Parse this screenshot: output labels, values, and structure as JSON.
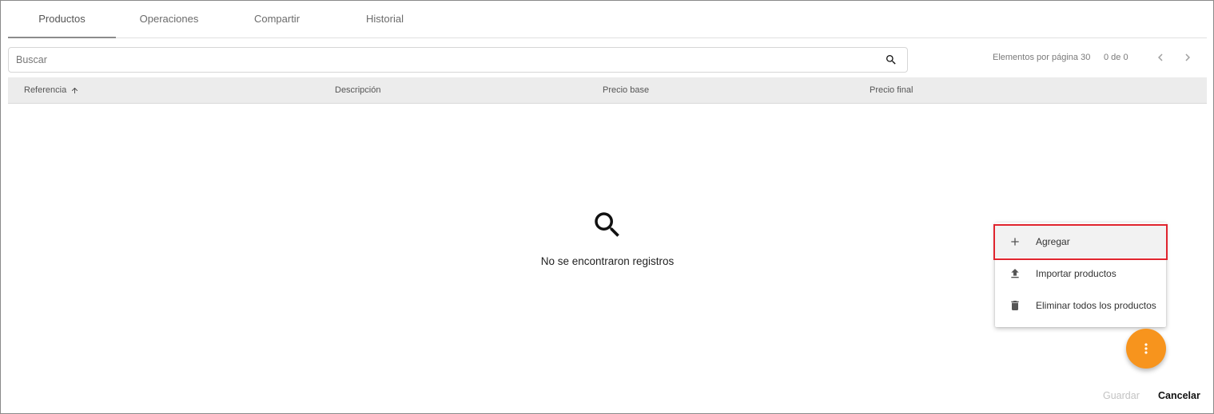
{
  "tabs": [
    {
      "label": "Productos",
      "active": true
    },
    {
      "label": "Operaciones",
      "active": false
    },
    {
      "label": "Compartir",
      "active": false
    },
    {
      "label": "Historial",
      "active": false
    }
  ],
  "search": {
    "placeholder": "Buscar",
    "value": "",
    "icon": "search-icon"
  },
  "pagination": {
    "items_per_page_label": "Elementos por página 30",
    "range": "0 de 0",
    "prev_icon": "chevron-left-icon",
    "next_icon": "chevron-right-icon"
  },
  "table": {
    "columns": [
      {
        "label": "Referencia",
        "sorted": "asc"
      },
      {
        "label": "Descripción"
      },
      {
        "label": "Precio base"
      },
      {
        "label": "Precio final"
      }
    ],
    "rows": []
  },
  "empty_state": {
    "icon": "search-icon",
    "message": "No se encontraron registros"
  },
  "actions_menu": {
    "items": [
      {
        "label": "Agregar",
        "icon": "plus-icon",
        "highlighted": true
      },
      {
        "label": "Importar productos",
        "icon": "upload-icon"
      },
      {
        "label": "Eliminar todos los productos",
        "icon": "trash-icon"
      }
    ]
  },
  "fab": {
    "icon": "more-vertical-icon",
    "color": "#f7941d"
  },
  "footer": {
    "save_label": "Guardar",
    "cancel_label": "Cancelar"
  },
  "colors": {
    "highlight": "#e0242e",
    "fab": "#f7941d",
    "header_bg": "#ececec"
  }
}
